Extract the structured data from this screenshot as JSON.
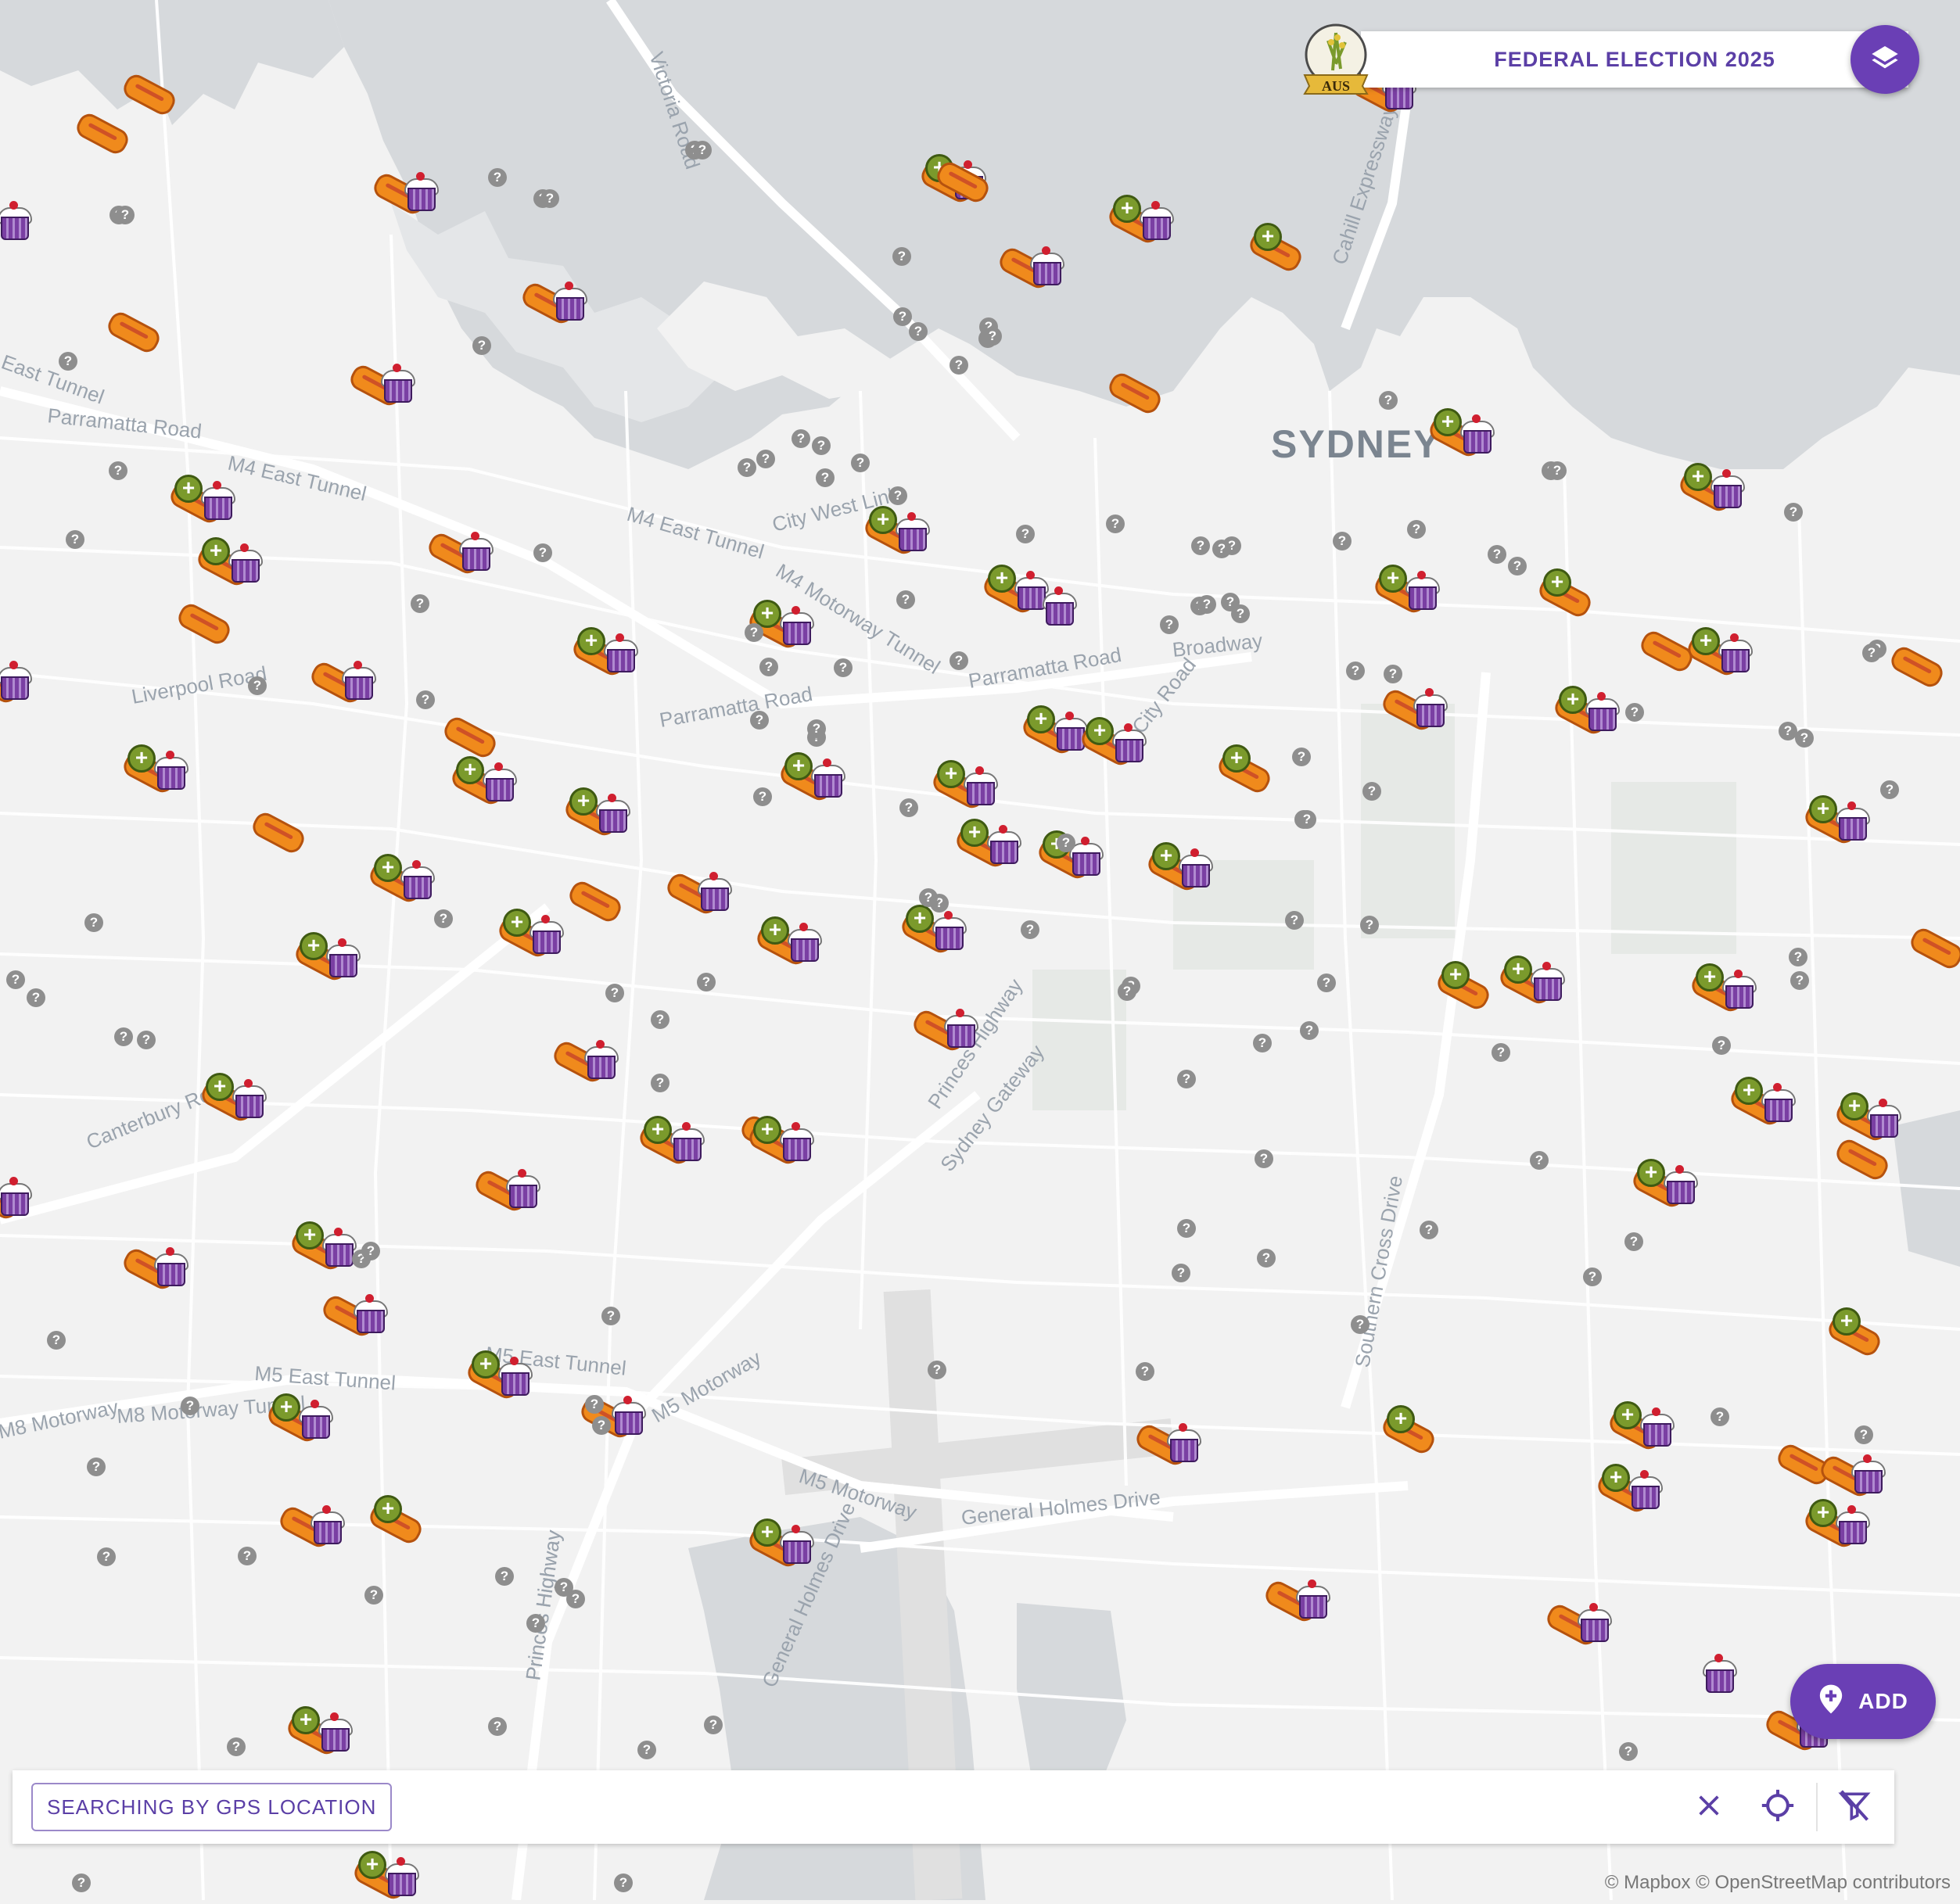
{
  "header": {
    "title": "FEDERAL ELECTION 2025",
    "emblem_text": "AUS"
  },
  "map": {
    "city_label": "SYDNEY",
    "road_labels": [
      "Victoria Road",
      "Cahill Expressway",
      "East Tunnel",
      "Parramatta Road",
      "M4 East Tunnel",
      "City West Link",
      "M4 East Tunnel",
      "M4 Motorway Tunnel",
      "Parramatta Road",
      "Broadway",
      "Liverpool Road",
      "Parramatta Road",
      "City Road",
      "Canterbury Road",
      "Princes Highway",
      "Sydney Gateway",
      "Southern Cross Drive",
      "M5 East Tunnel",
      "M5 East Tunnel",
      "M8 Motorway Tunnel",
      "M5 Motorway",
      "M8 Motorway",
      "Princes Highway",
      "M5 Motorway",
      "General Holmes Drive",
      "General Holmes Drive",
      "Princes Highway"
    ],
    "marker_legend": {
      "plus": "+",
      "unknown": "?"
    }
  },
  "add_button": {
    "label": "ADD"
  },
  "search": {
    "mode_label": "SEARCHING BY GPS LOCATION"
  },
  "icons": {
    "layers": "layers-icon",
    "add_location": "add-location-icon",
    "clear": "close-icon",
    "locate": "gps-crosshair-icon",
    "filter_off": "filter-off-icon"
  },
  "colors": {
    "accent": "#6a3fb5",
    "marker_plus": "#7b9a2c",
    "sausage": "#f08a1c",
    "cupcake": "#7a3fa3"
  },
  "attribution": "© Mapbox © OpenStreetMap contributors"
}
